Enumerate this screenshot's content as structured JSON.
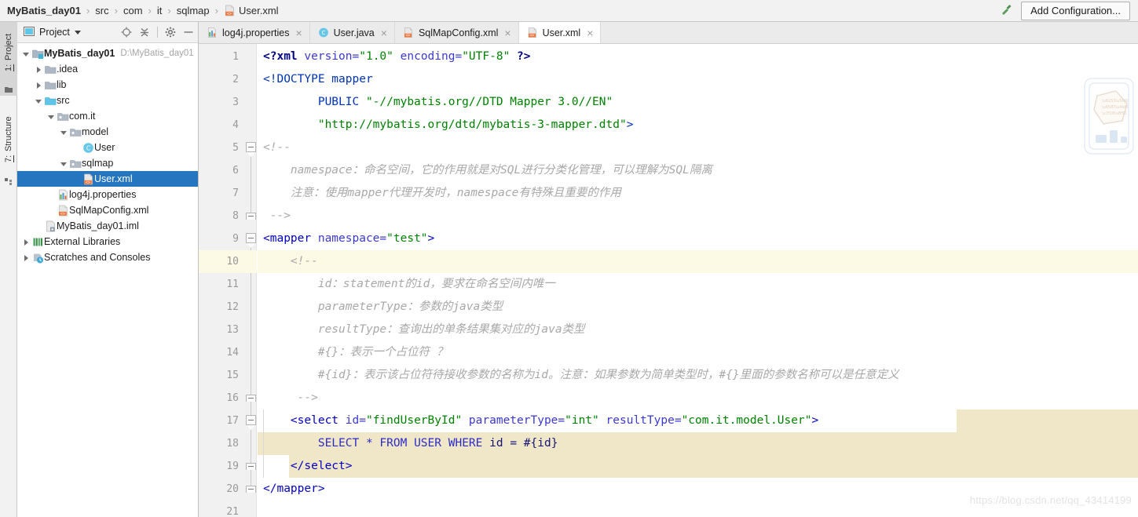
{
  "breadcrumb": {
    "items": [
      "MyBatis_day01",
      "src",
      "com",
      "it",
      "sqlmap",
      "User.xml"
    ],
    "separator": "›"
  },
  "toolbar": {
    "build_icon": "hammer-icon",
    "add_configuration_label": "Add Configuration..."
  },
  "left_strip": {
    "tabs": [
      {
        "num": "1:",
        "label": " Project",
        "active": true,
        "icon": "project-folder-icon"
      },
      {
        "num": "7:",
        "label": " Structure",
        "active": false,
        "icon": "structure-icon"
      }
    ]
  },
  "project_panel": {
    "title": "Project",
    "tools": [
      "locate-target-icon",
      "collapse-all-icon",
      "gear-icon",
      "minimize-icon"
    ],
    "tree": [
      {
        "label": "MyBatis_day01",
        "path": "D:\\MyBatis_day01",
        "depth": 0,
        "arrow": "down",
        "icon": "module-folder-icon",
        "bold": true,
        "selected": false
      },
      {
        "label": ".idea",
        "path": "",
        "depth": 1,
        "arrow": "right",
        "icon": "folder-gray-icon",
        "bold": false,
        "selected": false
      },
      {
        "label": "lib",
        "path": "",
        "depth": 1,
        "arrow": "right",
        "icon": "folder-gray-icon",
        "bold": false,
        "selected": false
      },
      {
        "label": "src",
        "path": "",
        "depth": 1,
        "arrow": "down",
        "icon": "source-folder-icon",
        "bold": false,
        "selected": false
      },
      {
        "label": "com.it",
        "path": "",
        "depth": 2,
        "arrow": "down",
        "icon": "package-icon",
        "bold": false,
        "selected": false
      },
      {
        "label": "model",
        "path": "",
        "depth": 3,
        "arrow": "down",
        "icon": "package-icon",
        "bold": false,
        "selected": false
      },
      {
        "label": "User",
        "path": "",
        "depth": 4,
        "arrow": "none",
        "icon": "java-class-icon",
        "bold": false,
        "selected": false
      },
      {
        "label": "sqlmap",
        "path": "",
        "depth": 3,
        "arrow": "down",
        "icon": "package-icon",
        "bold": false,
        "selected": false
      },
      {
        "label": "User.xml",
        "path": "",
        "depth": 4,
        "arrow": "none",
        "icon": "xml-file-icon",
        "bold": false,
        "selected": true
      },
      {
        "label": "log4j.properties",
        "path": "",
        "depth": 2,
        "arrow": "none",
        "icon": "properties-file-icon",
        "bold": false,
        "selected": false
      },
      {
        "label": "SqlMapConfig.xml",
        "path": "",
        "depth": 2,
        "arrow": "none",
        "icon": "xml-file-icon",
        "bold": false,
        "selected": false
      },
      {
        "label": "MyBatis_day01.iml",
        "path": "",
        "depth": 1,
        "arrow": "none",
        "icon": "iml-file-icon",
        "bold": false,
        "selected": false
      },
      {
        "label": "External Libraries",
        "path": "",
        "depth": 0,
        "arrow": "right",
        "icon": "libraries-icon",
        "bold": false,
        "selected": false
      },
      {
        "label": "Scratches and Consoles",
        "path": "",
        "depth": 0,
        "arrow": "right",
        "icon": "scratches-icon",
        "bold": false,
        "selected": false
      }
    ]
  },
  "editor": {
    "tabs": [
      {
        "label": "log4j.properties",
        "icon": "properties-file-icon",
        "active": false,
        "close": "×"
      },
      {
        "label": "User.java",
        "icon": "java-class-icon",
        "active": false,
        "close": "×"
      },
      {
        "label": "SqlMapConfig.xml",
        "icon": "xml-file-icon",
        "active": false,
        "close": "×"
      },
      {
        "label": "User.xml",
        "icon": "xml-file-icon",
        "active": true,
        "close": "×"
      }
    ],
    "line_numbers": [
      "1",
      "2",
      "3",
      "4",
      "5",
      "6",
      "7",
      "8",
      "9",
      "10",
      "11",
      "12",
      "13",
      "14",
      "15",
      "16",
      "17",
      "18",
      "19",
      "20",
      "21"
    ],
    "caret_line": 10,
    "highlight_block_lines": [
      17,
      18,
      19
    ],
    "lines": [
      {
        "n": 1,
        "indent": 0,
        "tokens": [
          {
            "t": "<?xml ",
            "c": "k-tagb"
          },
          {
            "t": "version=",
            "c": "k-attr"
          },
          {
            "t": "\"1.0\"",
            "c": "k-str"
          },
          {
            "t": " ",
            "c": "k-plain"
          },
          {
            "t": "encoding=",
            "c": "k-attr"
          },
          {
            "t": "\"UTF-8\"",
            "c": "k-str"
          },
          {
            "t": " ?>",
            "c": "k-tagb"
          }
        ]
      },
      {
        "n": 2,
        "indent": 0,
        "tokens": [
          {
            "t": "<!DOCTYPE mapper",
            "c": "k-doc"
          }
        ]
      },
      {
        "n": 3,
        "indent": 0,
        "tokens": [
          {
            "t": "        PUBLIC ",
            "c": "k-doc"
          },
          {
            "t": "\"-//mybatis.org//DTD Mapper 3.0//EN\"",
            "c": "k-str"
          }
        ]
      },
      {
        "n": 4,
        "indent": 0,
        "tokens": [
          {
            "t": "        ",
            "c": "k-plain"
          },
          {
            "t": "\"http://mybatis.org/dtd/mybatis-3-mapper.dtd\"",
            "c": "k-str"
          },
          {
            "t": ">",
            "c": "k-doc"
          }
        ]
      },
      {
        "n": 5,
        "indent": 0,
        "tokens": [
          {
            "t": "<!--",
            "c": "k-cmt"
          }
        ]
      },
      {
        "n": 6,
        "indent": 0,
        "tokens": [
          {
            "t": "    namespace：命名空间，它的作用就是对SQL进行分类化管理，可以理解为SQL隔离",
            "c": "k-cmt"
          }
        ]
      },
      {
        "n": 7,
        "indent": 0,
        "tokens": [
          {
            "t": "    注意：使用mapper代理开发时，namespace有特殊且重要的作用",
            "c": "k-cmt"
          }
        ]
      },
      {
        "n": 8,
        "indent": 0,
        "tokens": [
          {
            "t": " -->",
            "c": "k-cmt"
          }
        ]
      },
      {
        "n": 9,
        "indent": 0,
        "tokens": [
          {
            "t": "<mapper ",
            "c": "k-tag"
          },
          {
            "t": "namespace=",
            "c": "k-attr"
          },
          {
            "t": "\"test\"",
            "c": "k-str"
          },
          {
            "t": ">",
            "c": "k-tag"
          }
        ]
      },
      {
        "n": 10,
        "indent": 0,
        "tokens": [
          {
            "t": "    <!--",
            "c": "k-cmt"
          }
        ]
      },
      {
        "n": 11,
        "indent": 0,
        "tokens": [
          {
            "t": "        id：statement的id，要求在命名空间内唯一",
            "c": "k-cmt"
          }
        ]
      },
      {
        "n": 12,
        "indent": 0,
        "tokens": [
          {
            "t": "        parameterType：参数的java类型",
            "c": "k-cmt"
          }
        ]
      },
      {
        "n": 13,
        "indent": 0,
        "tokens": [
          {
            "t": "        resultType：查询出的单条结果集对应的java类型",
            "c": "k-cmt"
          }
        ]
      },
      {
        "n": 14,
        "indent": 0,
        "tokens": [
          {
            "t": "        #{}：表示一个占位符 ？",
            "c": "k-cmt"
          }
        ]
      },
      {
        "n": 15,
        "indent": 0,
        "tokens": [
          {
            "t": "        #{id}：表示该占位符待接收参数的名称为id。注意：如果参数为简单类型时，#{}里面的参数名称可以是任意定义",
            "c": "k-cmt"
          }
        ]
      },
      {
        "n": 16,
        "indent": 0,
        "tokens": [
          {
            "t": "     -->",
            "c": "k-cmt"
          }
        ]
      },
      {
        "n": 17,
        "indent": 0,
        "tokens": [
          {
            "t": "    <select ",
            "c": "k-tag"
          },
          {
            "t": "id=",
            "c": "k-attr"
          },
          {
            "t": "\"findUserById\"",
            "c": "k-str"
          },
          {
            "t": " ",
            "c": "k-plain"
          },
          {
            "t": "parameterType=",
            "c": "k-attr"
          },
          {
            "t": "\"int\"",
            "c": "k-str"
          },
          {
            "t": " ",
            "c": "k-plain"
          },
          {
            "t": "resultType=",
            "c": "k-attr"
          },
          {
            "t": "\"com.it.model.User\"",
            "c": "k-str"
          },
          {
            "t": ">",
            "c": "k-tag"
          }
        ]
      },
      {
        "n": 18,
        "indent": 0,
        "tokens": [
          {
            "t": "        ",
            "c": "k-plain"
          },
          {
            "t": "SELECT ",
            "c": "k-sql"
          },
          {
            "t": "* ",
            "c": "k-sql"
          },
          {
            "t": "FROM ",
            "c": "k-sql"
          },
          {
            "t": "USER ",
            "c": "k-sql"
          },
          {
            "t": "WHERE ",
            "c": "k-sql"
          },
          {
            "t": "id = #{id}",
            "c": "k-sqlp"
          }
        ]
      },
      {
        "n": 19,
        "indent": 0,
        "tokens": [
          {
            "t": "    </select>",
            "c": "k-tag"
          }
        ]
      },
      {
        "n": 20,
        "indent": 0,
        "tokens": [
          {
            "t": "</mapper>",
            "c": "k-tag"
          }
        ]
      },
      {
        "n": 21,
        "indent": 0,
        "tokens": []
      }
    ],
    "fold_markers": [
      {
        "line": 5,
        "type": "start"
      },
      {
        "line": 8,
        "type": "end"
      },
      {
        "line": 9,
        "type": "start"
      },
      {
        "line": 10,
        "type": "start"
      },
      {
        "line": 16,
        "type": "end"
      },
      {
        "line": 17,
        "type": "start"
      },
      {
        "line": 19,
        "type": "end"
      },
      {
        "line": 20,
        "type": "end"
      }
    ]
  },
  "watermark": {
    "url": "https://blog.csdn.net/qq_43414199",
    "illustration": "decorative-sketch-watermark"
  },
  "colors": {
    "selection_blue": "#2675bf",
    "caret_line": "#fcf9e4",
    "block_highlight": "#f0e6c8",
    "tag": "#0000c0",
    "attribute": "#3a3acc",
    "string": "#008000",
    "comment": "#a8a8a8",
    "sql_keyword": "#2b2bc8",
    "topbar_bg": "#f2f2f2",
    "gutter_bg": "#f1f1f1"
  }
}
